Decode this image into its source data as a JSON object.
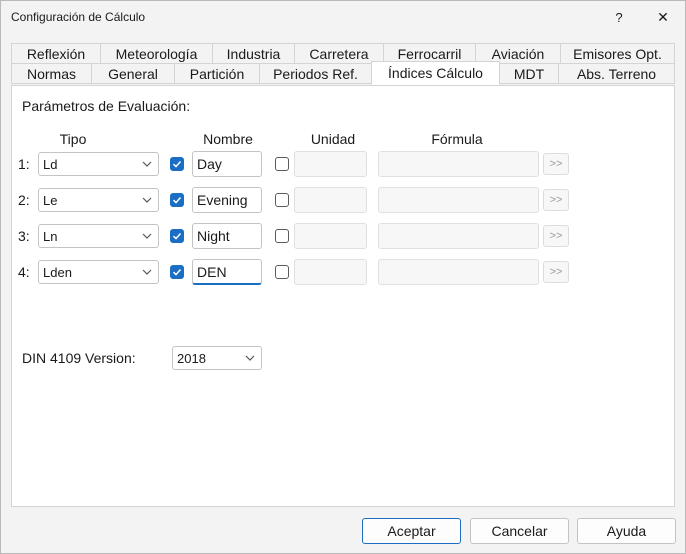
{
  "window": {
    "title": "Configuración de Cálculo",
    "help_glyph": "?",
    "close_glyph": "✕"
  },
  "tabs_row1": [
    "Reflexión",
    "Meteorología",
    "Industria",
    "Carretera",
    "Ferrocarril",
    "Aviación",
    "Emisores Opt."
  ],
  "tabs_row2": [
    "Normas",
    "General",
    "Partición",
    "Periodos Ref.",
    "Índices Cálculo",
    "MDT",
    "Abs. Terreno"
  ],
  "active_tab": "Índices Cálculo",
  "panel": {
    "section_label": "Parámetros de Evaluación:",
    "headers": {
      "tipo": "Tipo",
      "nombre": "Nombre",
      "unidad": "Unidad",
      "formula": "Fórmula"
    },
    "rows": [
      {
        "index": "1:",
        "tipo": "Ld",
        "nombre_checked": true,
        "nombre": "Day",
        "unidad_checked": false,
        "unidad": "",
        "formula": "",
        "button": ">>"
      },
      {
        "index": "2:",
        "tipo": "Le",
        "nombre_checked": true,
        "nombre": "Evening",
        "unidad_checked": false,
        "unidad": "",
        "formula": "",
        "button": ">>"
      },
      {
        "index": "3:",
        "tipo": "Ln",
        "nombre_checked": true,
        "nombre": "Night",
        "unidad_checked": false,
        "unidad": "",
        "formula": "",
        "button": ">>"
      },
      {
        "index": "4:",
        "tipo": "Lden",
        "nombre_checked": true,
        "nombre": "DEN",
        "unidad_checked": false,
        "unidad": "",
        "formula": "",
        "button": ">>"
      }
    ],
    "din": {
      "label": "DIN 4109 Version:",
      "value": "2018"
    }
  },
  "footer": {
    "accept": "Aceptar",
    "cancel": "Cancelar",
    "help": "Ayuda"
  },
  "colors": {
    "accent": "#1a6fc4",
    "background": "#f3f3f3",
    "panel": "#ffffff"
  }
}
